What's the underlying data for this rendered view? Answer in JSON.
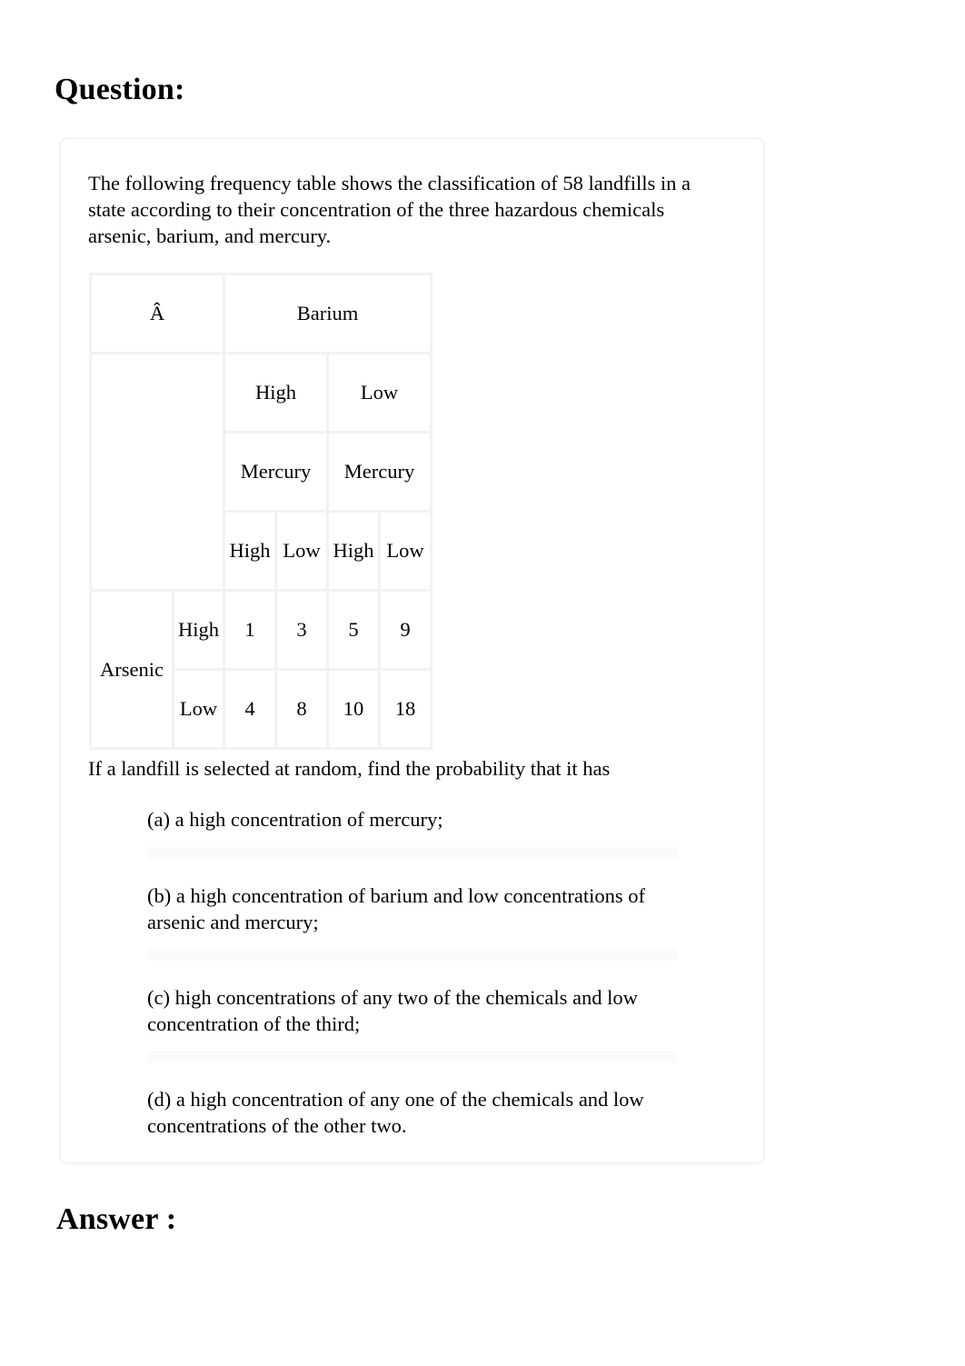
{
  "page": {
    "question_heading": "Question:",
    "answer_heading": "Answer :"
  },
  "card": {
    "intro": "The following frequency table shows the classification of 58 landfills in a state according to their concentration of the three hazardous chemicals arsenic, barium, and mercury.",
    "prompt": "If a landfill is selected at random, find the probability that it has",
    "items": [
      {
        "label": "(a) a high concentration of mercury;"
      },
      {
        "label": "(b) a high concentration of barium and low concentrations of arsenic and mercury;"
      },
      {
        "label": "(c) high concentrations of any two of the chemicals and low concentration of the third;"
      },
      {
        "label": "(d) a high concentration of any one of the chemicals and low concentrations of the other two."
      }
    ]
  },
  "chart_data": {
    "type": "table",
    "title": "Frequency table of 58 landfills by concentration of arsenic, barium, and mercury",
    "corner_label": "Â",
    "col_group_label": "Barium",
    "barium_levels": [
      "High",
      "Low"
    ],
    "mercury_labels": [
      "Mercury",
      "Mercury"
    ],
    "mercury_levels": [
      "High",
      "Low",
      "High",
      "Low"
    ],
    "row_group_label": "Arsenic",
    "row_levels": [
      "High",
      "Low"
    ],
    "values": [
      [
        1,
        3,
        5,
        9
      ],
      [
        4,
        8,
        10,
        18
      ]
    ],
    "total": 58,
    "columns": [
      "Barium High / Mercury High",
      "Barium High / Mercury Low",
      "Barium Low / Mercury High",
      "Barium Low / Mercury Low"
    ],
    "rows": [
      "Arsenic High",
      "Arsenic Low"
    ]
  }
}
